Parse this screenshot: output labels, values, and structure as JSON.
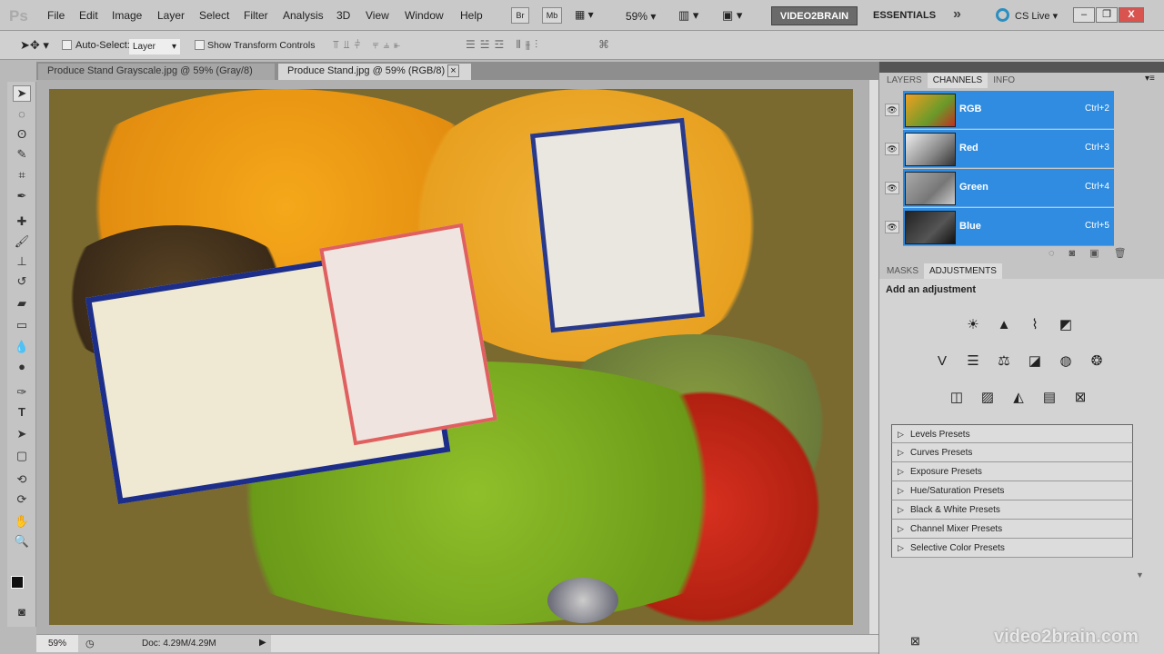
{
  "app": {
    "logo": "Ps",
    "menus": [
      "File",
      "Edit",
      "Image",
      "Layer",
      "Select",
      "Filter",
      "Analysis",
      "3D",
      "View",
      "Window",
      "Help"
    ],
    "bridge_buttons": [
      "Br",
      "Mb"
    ],
    "zoom": "59%",
    "workspaces": [
      "VIDEO2BRAIN",
      "ESSENTIALS"
    ],
    "more": "»",
    "cs_live": "CS Live ▾"
  },
  "options": {
    "auto_select_label": "Auto-Select:",
    "auto_select_value": "Layer",
    "show_transform_label": "Show Transform Controls",
    "auto_select_checked": false,
    "show_transform_checked": false
  },
  "tabs": [
    {
      "label": "Produce Stand Grayscale.jpg @ 59% (Gray/8)",
      "active": false
    },
    {
      "label": "Produce Stand.jpg @ 59% (RGB/8)",
      "active": true
    }
  ],
  "status": {
    "zoom": "59%",
    "doc": "Doc: 4.29M/4.29M"
  },
  "channels_panel": {
    "tabs": [
      "LAYERS",
      "CHANNELS",
      "INFO"
    ],
    "active_tab": "CHANNELS",
    "channels": [
      {
        "name": "RGB",
        "shortcut": "Ctrl+2"
      },
      {
        "name": "Red",
        "shortcut": "Ctrl+3"
      },
      {
        "name": "Green",
        "shortcut": "Ctrl+4"
      },
      {
        "name": "Blue",
        "shortcut": "Ctrl+5"
      }
    ]
  },
  "adjustments_panel": {
    "tabs": [
      "MASKS",
      "ADJUSTMENTS"
    ],
    "active_tab": "ADJUSTMENTS",
    "heading": "Add an adjustment",
    "presets": [
      "Levels Presets",
      "Curves Presets",
      "Exposure Presets",
      "Hue/Saturation Presets",
      "Black & White Presets",
      "Channel Mixer Presets",
      "Selective Color Presets"
    ]
  },
  "watermark": "video2brain.com",
  "colors": {
    "selection": "#2f8ce0",
    "workspace_active": "#6a6a6a",
    "close": "#d9534f"
  }
}
